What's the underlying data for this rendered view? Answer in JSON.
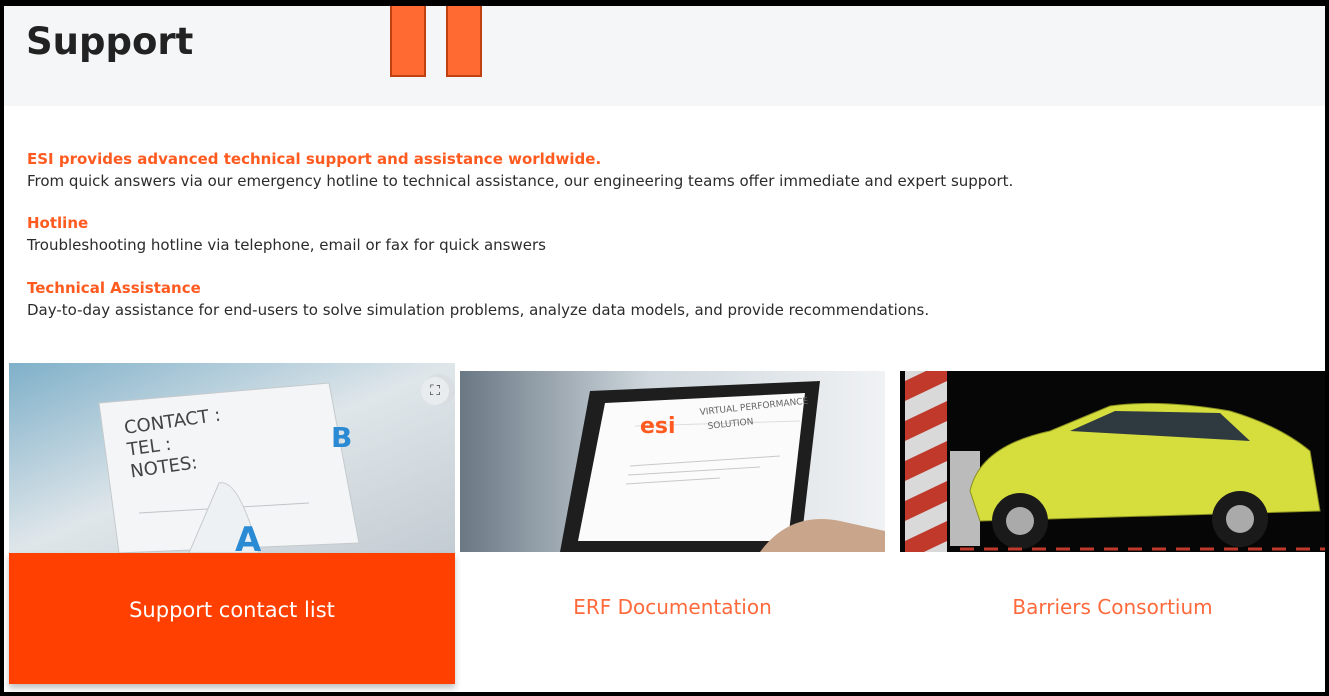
{
  "header": {
    "title": "Support"
  },
  "intro": {
    "heading": "ESI provides advanced technical support and assistance worldwide.",
    "text": "From quick answers via our emergency hotline to technical assistance, our engineering teams offer immediate and expert support."
  },
  "hotline": {
    "heading": "Hotline",
    "text": "Troubleshooting hotline via telephone, email or fax for quick answers"
  },
  "assistance": {
    "heading": "Technical Assistance",
    "text": "Day-to-day assistance for end-users to solve simulation problems, analyze data models, and provide recommendations."
  },
  "cards": [
    {
      "label": "Support contact list",
      "image_text": [
        "CONTACT :",
        "TEL :",
        "NOTES:"
      ]
    },
    {
      "label": "ERF Documentation",
      "image_text": [
        "VIRTUAL PERFORMANCE",
        "SOLUTION"
      ]
    },
    {
      "label": "Barriers Consortium"
    }
  ],
  "colors": {
    "accent": "#ff5a1f",
    "card_active": "#ff4000",
    "header_bg": "#f5f6f8"
  },
  "icons": {
    "visual_search": "visual-search-icon"
  }
}
